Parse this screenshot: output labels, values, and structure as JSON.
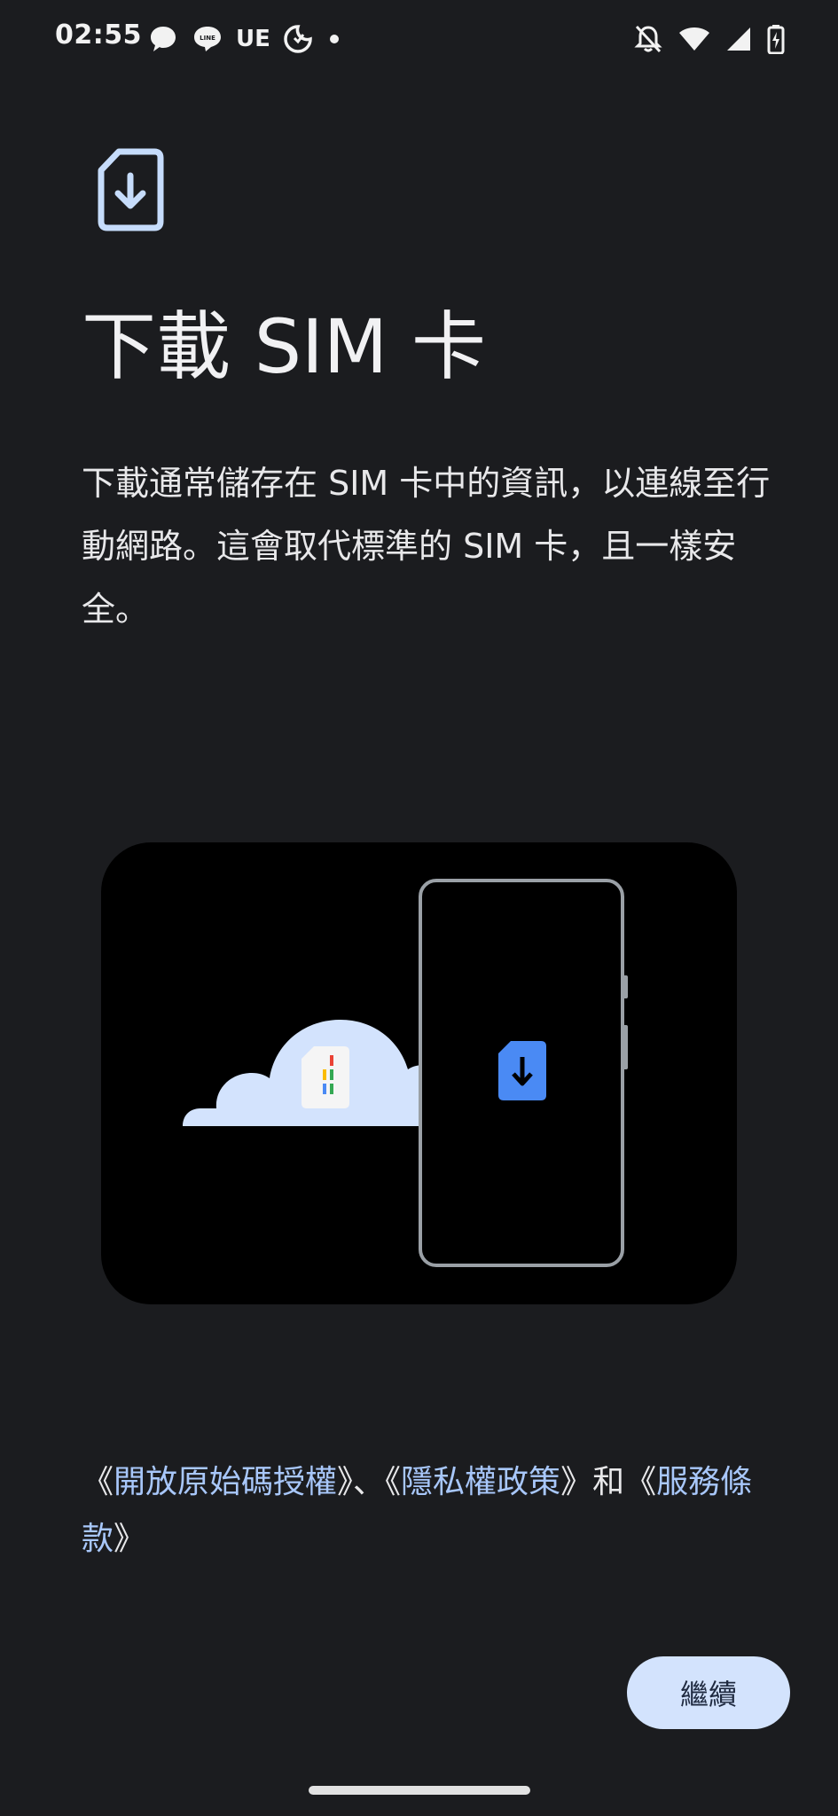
{
  "status_bar": {
    "time": "02:55",
    "carrier_text": "UE",
    "left_icons": [
      "chat-bubble-icon",
      "line-app-icon",
      "carrier-text-icon",
      "do-not-disturb-moon-icon",
      "notification-dot-icon"
    ],
    "right_icons": [
      "silent-bell-off-icon",
      "wifi-icon",
      "cellular-signal-icon",
      "battery-charging-icon"
    ]
  },
  "header": {
    "icon": "sim-download-icon",
    "title": "下載 SIM 卡"
  },
  "description": "下載通常儲存在 SIM 卡中的資訊，以連線至行動網路。這會取代標準的 SIM 卡，且一樣安全。",
  "illustration": {
    "elements": [
      "cloud-icon",
      "sim-card-icon",
      "phone-outline",
      "sim-download-icon"
    ],
    "colors": {
      "cloud": "#d3e3fd",
      "sim_card": "#f5f5f5",
      "phone_outline": "#9aa0a6",
      "phone_sim": "#4a8af4",
      "sim_stripe_red": "#ea4335",
      "sim_stripe_yellow": "#fbbc04",
      "sim_stripe_green": "#34a853"
    }
  },
  "legal": {
    "open_quote_1": "《",
    "open_source_link": "開放原始碼授權",
    "sep_1": "》、《",
    "privacy_link": "隱私權政策",
    "sep_2": "》和《",
    "terms_link": "服務條款",
    "close_quote": "》"
  },
  "continue_button": {
    "label": "繼續"
  },
  "colors": {
    "background": "#1b1c1f",
    "link": "#a8c7fa",
    "button_bg": "#d3e3fd",
    "button_text": "#1f2a40"
  }
}
